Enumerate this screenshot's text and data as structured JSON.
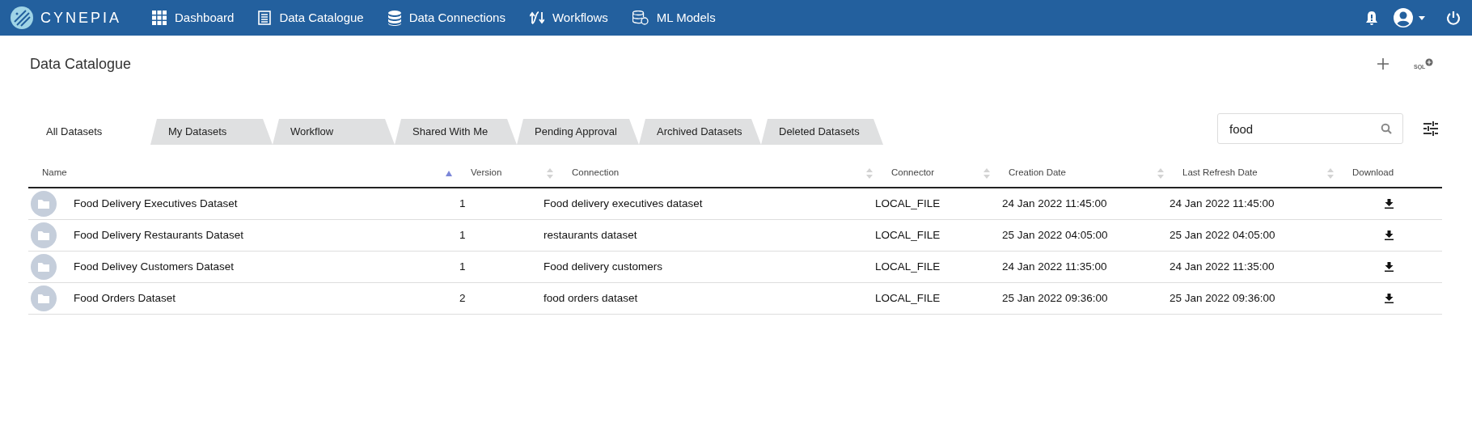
{
  "navbar": {
    "logo": "CYNEPIA",
    "items": [
      {
        "label": "Dashboard"
      },
      {
        "label": "Data Catalogue"
      },
      {
        "label": "Data Connections"
      },
      {
        "label": "Workflows"
      },
      {
        "label": "ML Models"
      }
    ]
  },
  "page": {
    "title": "Data Catalogue",
    "sql_button": "SQL"
  },
  "tabs": [
    {
      "label": "All Datasets",
      "selected": true
    },
    {
      "label": "My Datasets",
      "selected": false
    },
    {
      "label": "Workflow",
      "selected": false
    },
    {
      "label": "Shared With Me",
      "selected": false
    },
    {
      "label": "Pending Approval",
      "selected": false
    },
    {
      "label": "Archived Datasets",
      "selected": false
    },
    {
      "label": "Deleted Datasets",
      "selected": false
    }
  ],
  "search": {
    "value": "food"
  },
  "table": {
    "columns": [
      {
        "label": "Name",
        "sorted": true
      },
      {
        "label": "Version",
        "sorted": false
      },
      {
        "label": "Connection",
        "sorted": false
      },
      {
        "label": "Connector",
        "sorted": false
      },
      {
        "label": "Creation Date",
        "sorted": false
      },
      {
        "label": "Last Refresh Date",
        "sorted": false
      },
      {
        "label": "Download"
      }
    ],
    "rows": [
      [
        "Food Delivery Executives Dataset",
        "1",
        "Food delivery executives dataset",
        "LOCAL_FILE",
        "24 Jan 2022 11:45:00",
        "24 Jan 2022 11:45:00"
      ],
      [
        "Food Delivery Restaurants Dataset",
        "1",
        "restaurants dataset",
        "LOCAL_FILE",
        "25 Jan 2022 04:05:00",
        "25 Jan 2022 04:05:00"
      ],
      [
        "Food Delivey Customers Dataset",
        "1",
        "Food delivery customers",
        "LOCAL_FILE",
        "24 Jan 2022 11:35:00",
        "24 Jan 2022 11:35:00"
      ],
      [
        "Food Orders Dataset",
        "2",
        "food orders dataset",
        "LOCAL_FILE",
        "25 Jan 2022 09:36:00",
        "25 Jan 2022 09:36:00"
      ]
    ]
  }
}
